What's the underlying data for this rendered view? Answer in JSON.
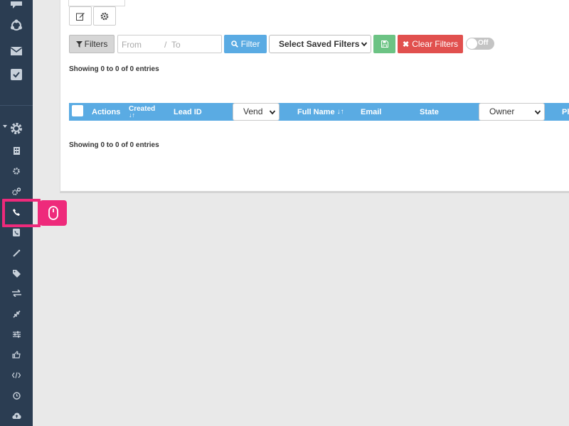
{
  "sidebar": {
    "icons": [
      "chat-icon",
      "network-icon",
      "mail-icon",
      "checkbox-icon",
      "gear-icon",
      "building-icon",
      "small-gear-icon",
      "gears-icon",
      "phone-icon",
      "phone-book-icon",
      "magic-wand-icon",
      "tag-icon",
      "transfer-icon",
      "compress-icon",
      "sliders-icon",
      "hand-pointer-icon",
      "code-icon",
      "clock-icon",
      "cloud-upload-icon"
    ],
    "active_item": "phone-icon"
  },
  "toolbar": {
    "filters_label": "Filters",
    "from_placeholder": "From",
    "separator": "/",
    "to_placeholder": "To",
    "filter_label": "Filter",
    "saved_filters_label": "Select Saved Filters",
    "clear_filters_label": "Clear Filters",
    "toggle_label": "Off"
  },
  "showing_top": "Showing 0 to 0 of 0 entries",
  "showing_bottom": "Showing 0 to 0 of 0 entries",
  "table": {
    "columns": {
      "actions": "Actions",
      "created": "Created",
      "lead_id": "Lead ID",
      "vendor": "Vend",
      "full_name": "Full Name",
      "email": "Email",
      "state": "State",
      "owner": "Owner",
      "last": "Ph"
    }
  },
  "colors": {
    "sidebar_bg": "#2b3d52",
    "accent_blue": "#5aabe3",
    "danger_red": "#e1504e",
    "success_green": "#6cc384",
    "highlight_pink": "#ee2a7b"
  }
}
